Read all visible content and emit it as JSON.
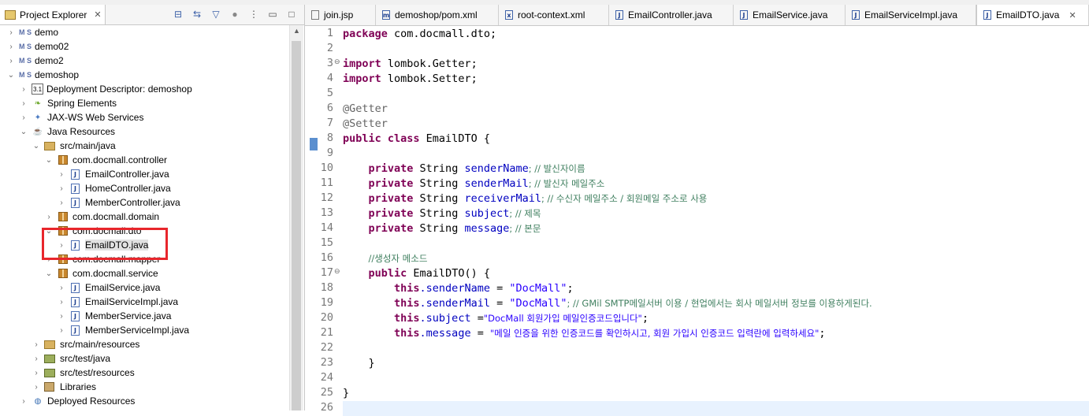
{
  "explorer": {
    "tab_label": "Project Explorer",
    "tab_close": "✕",
    "tree": [
      {
        "label": "demo",
        "icon": "project-icon",
        "chevron": "›"
      },
      {
        "label": "demo02",
        "icon": "project-icon",
        "chevron": "›"
      },
      {
        "label": "demo2",
        "icon": "project-icon",
        "chevron": "›"
      },
      {
        "label": "demoshop",
        "icon": "project-icon",
        "chevron": "⌄"
      },
      {
        "label": "Deployment Descriptor: demoshop",
        "icon": "deployment-descriptor-icon",
        "chevron": "›"
      },
      {
        "label": "Spring Elements",
        "icon": "spring-leaf-icon",
        "chevron": "›"
      },
      {
        "label": "JAX-WS Web Services",
        "icon": "web-services-icon",
        "chevron": "›"
      },
      {
        "label": "Java Resources",
        "icon": "java-resources-icon",
        "chevron": "⌄"
      },
      {
        "label": "src/main/java",
        "icon": "source-folder-icon",
        "chevron": "⌄"
      },
      {
        "label": "com.docmall.controller",
        "icon": "package-icon",
        "chevron": "⌄"
      },
      {
        "label": "EmailController.java",
        "icon": "java-file-icon",
        "chevron": "›"
      },
      {
        "label": "HomeController.java",
        "icon": "java-file-icon",
        "chevron": "›"
      },
      {
        "label": "MemberController.java",
        "icon": "java-file-icon",
        "chevron": "›"
      },
      {
        "label": "com.docmall.domain",
        "icon": "package-icon",
        "chevron": "›"
      },
      {
        "label": "com.docmall.dto",
        "icon": "package-icon",
        "chevron": "⌄"
      },
      {
        "label": "EmailDTO.java",
        "icon": "java-file-icon",
        "chevron": "›"
      },
      {
        "label": "com.docmall.mapper",
        "icon": "package-icon",
        "chevron": "›"
      },
      {
        "label": "com.docmall.service",
        "icon": "package-icon",
        "chevron": "⌄"
      },
      {
        "label": "EmailService.java",
        "icon": "java-file-icon",
        "chevron": "›"
      },
      {
        "label": "EmailServiceImpl.java",
        "icon": "java-file-icon",
        "chevron": "›"
      },
      {
        "label": "MemberService.java",
        "icon": "java-file-icon",
        "chevron": "›"
      },
      {
        "label": "MemberServiceImpl.java",
        "icon": "java-file-icon",
        "chevron": "›"
      },
      {
        "label": "src/main/resources",
        "icon": "source-folder-icon",
        "chevron": "›"
      },
      {
        "label": "src/test/java",
        "icon": "test-source-folder-icon",
        "chevron": "›"
      },
      {
        "label": "src/test/resources",
        "icon": "test-source-folder-icon",
        "chevron": "›"
      },
      {
        "label": "Libraries",
        "icon": "libraries-icon",
        "chevron": "›"
      },
      {
        "label": "Deployed Resources",
        "icon": "deployed-resources-icon",
        "chevron": "›"
      }
    ],
    "selected_item": "EmailDTO.java",
    "highlight_color": "#e8262c"
  },
  "editor": {
    "tabs": [
      {
        "label": "join.jsp",
        "icon": "jsp-file-icon"
      },
      {
        "label": "demoshop/pom.xml",
        "icon": "maven-file-icon"
      },
      {
        "label": "root-context.xml",
        "icon": "xml-file-icon"
      },
      {
        "label": "EmailController.java",
        "icon": "java-file-icon"
      },
      {
        "label": "EmailService.java",
        "icon": "java-file-icon"
      },
      {
        "label": "EmailServiceImpl.java",
        "icon": "java-file-icon"
      },
      {
        "label": "EmailDTO.java",
        "icon": "java-file-icon",
        "active": true
      }
    ],
    "active_tab_close": "✕",
    "line_numbers": [
      "1",
      "2",
      "3",
      "4",
      "5",
      "6",
      "7",
      "8",
      "9",
      "10",
      "11",
      "12",
      "13",
      "14",
      "15",
      "16",
      "17",
      "18",
      "19",
      "20",
      "21",
      "22",
      "23",
      "24",
      "25",
      "26"
    ],
    "code": {
      "l1_kw": "package",
      "l1_rest": " com.docmall.dto;",
      "l3_kw": "import",
      "l3_rest": " lombok.Getter;",
      "l4_kw": "import",
      "l4_rest": " lombok.Setter;",
      "l6": "@Getter",
      "l7": "@Setter",
      "l8_kw": "public class",
      "l8_rest": " EmailDTO {",
      "private_kw": "private",
      "string_type": " String ",
      "l10_field": "senderName",
      "l10_comment": "; // 발신자이름",
      "l11_field": "senderMail",
      "l11_comment": "; // 발신자 메일주소",
      "l12_field": "receiverMail",
      "l12_comment": "; // 수신자 메일주소 / 회원메일 주소로 사용",
      "l13_field": "subject",
      "l13_comment": "; // 제목",
      "l14_field": "message",
      "l14_comment": "; // 본문",
      "l16": "//생성자 메소드",
      "l17_kw": "public",
      "l17_rest": " EmailDTO() {",
      "this_kw": "this",
      "l18_field": ".senderName",
      "l18_eq": " = ",
      "l18_str": "\"DocMall\"",
      "l18_end": ";",
      "l19_field": ".senderMail",
      "l19_eq": " = ",
      "l19_str": "\"DocMall\"",
      "l19_end": "; // GMil SMTP메일서버 이용 / 현업에서는 회사 메일서버 정보를 이용하게된다.",
      "l20_field": ".subject",
      "l20_eq": " =",
      "l20_str": "\"DocMall 회원가입 메일인증코드입니다\"",
      "l20_end": ";",
      "l21_field": ".message",
      "l21_eq": " = ",
      "l21_str": "\"메일 인증을 위한 인증코드를 확인하시고, 회원 가입시 인증코드 입력란에 입력하세요\"",
      "l21_end": ";",
      "l23": "    }",
      "l25": "}"
    },
    "keyword_color": "#7f0055",
    "field_color": "#0000c0",
    "comment_color": "#3f7f5f",
    "string_color": "#2a00ff"
  }
}
